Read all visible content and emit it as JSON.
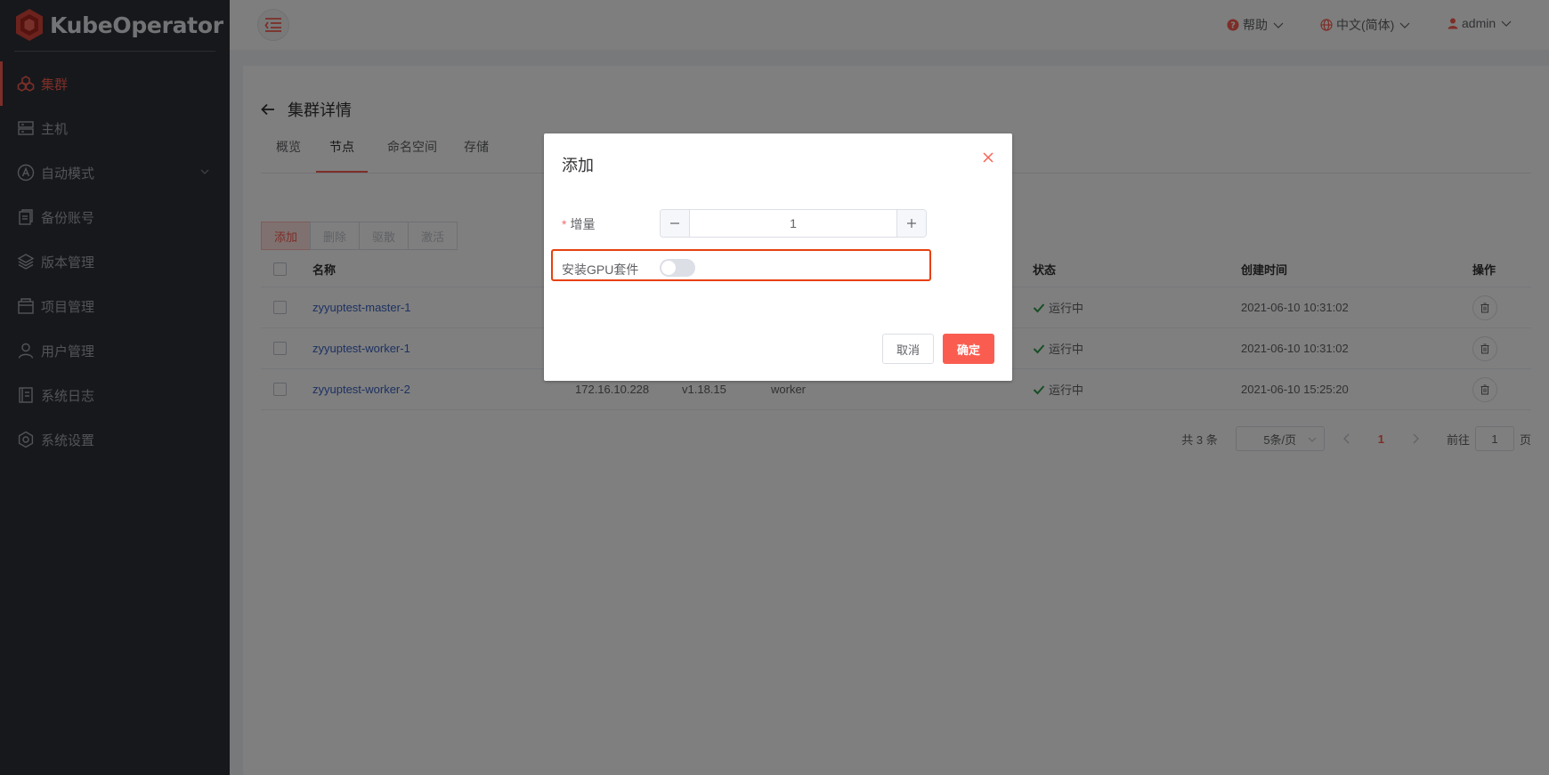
{
  "app": {
    "logo_text": "KubeOperator",
    "accent_color": "#fa5d50"
  },
  "sidebar": {
    "items": [
      {
        "label": "集群",
        "icon": "cluster-icon",
        "active": true
      },
      {
        "label": "主机",
        "icon": "server-icon"
      },
      {
        "label": "自动模式",
        "icon": "auto-mode-icon",
        "has_children": true
      },
      {
        "label": "备份账号",
        "icon": "backup-icon"
      },
      {
        "label": "版本管理",
        "icon": "layers-icon"
      },
      {
        "label": "项目管理",
        "icon": "project-icon"
      },
      {
        "label": "用户管理",
        "icon": "user-icon"
      },
      {
        "label": "系统日志",
        "icon": "log-icon"
      },
      {
        "label": "系统设置",
        "icon": "gear-icon"
      }
    ]
  },
  "header": {
    "help": "帮助",
    "language": "中文(简体)",
    "user": "admin"
  },
  "page": {
    "title": "集群详情",
    "tabs": [
      "概览",
      "节点",
      "命名空间",
      "存储"
    ],
    "active_tab": "节点",
    "actions": [
      "添加",
      "删除",
      "驱散",
      "激活"
    ]
  },
  "table": {
    "headers": {
      "name": "名称",
      "status": "状态",
      "created": "创建时间",
      "ops": "操作"
    },
    "rows": [
      {
        "name": "zyyuptest-master-1",
        "ip": "",
        "version": "",
        "role": "",
        "status": "运行中",
        "created": "2021-06-10 10:31:02"
      },
      {
        "name": "zyyuptest-worker-1",
        "ip": "",
        "version": "",
        "role": "",
        "status": "运行中",
        "created": "2021-06-10 10:31:02"
      },
      {
        "name": "zyyuptest-worker-2",
        "ip": "172.16.10.228",
        "version": "v1.18.15",
        "role": "worker",
        "status": "运行中",
        "created": "2021-06-10 15:25:20"
      }
    ]
  },
  "pagination": {
    "total": "共 3 条",
    "page_size": "5条/页",
    "current_page": "1",
    "goto_label": "前往",
    "goto_value": "1",
    "page_suffix": "页"
  },
  "dialog": {
    "title": "添加",
    "increment_label": "增量",
    "increment_required": "*",
    "increment_value": "1",
    "gpu_label": "安装GPU套件",
    "gpu_enabled": false,
    "cancel": "取消",
    "confirm": "确定"
  }
}
